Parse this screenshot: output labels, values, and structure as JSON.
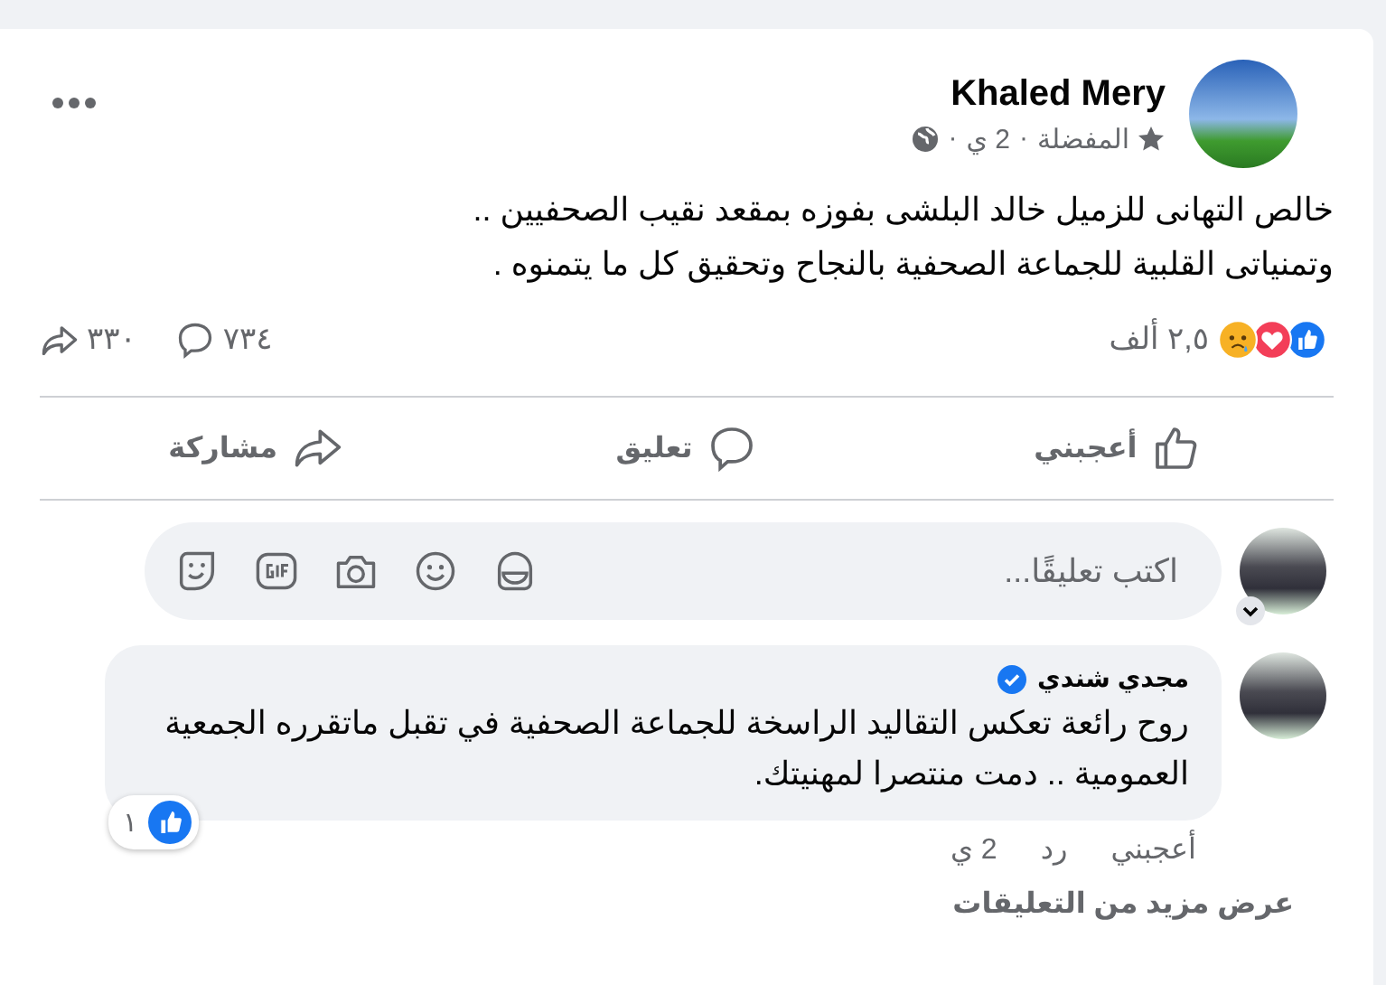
{
  "post": {
    "author": "Khaled Mery",
    "audience": "المفضلة",
    "separator": "·",
    "time": "2 ي",
    "text_lines": [
      "خالص التهانى للزميل خالد البلشى بفوزه بمقعد نقيب الصحفيين ..",
      "وتمنياتى القلبية للجماعة الصحفية بالنجاح وتحقيق كل ما يتمنوه ."
    ],
    "reactions": [
      {
        "kind": "like"
      },
      {
        "kind": "love"
      },
      {
        "kind": "sad"
      }
    ],
    "reaction_count": "٢,٥ ألف",
    "comment_count": "٧٣٤",
    "share_count": "٣٣٠",
    "actions": [
      {
        "kind": "like",
        "label": "أعجبني"
      },
      {
        "kind": "comment",
        "label": "تعليق"
      },
      {
        "kind": "share",
        "label": "مشاركة"
      }
    ]
  },
  "composer": {
    "placeholder": "اكتب تعليقًا..."
  },
  "comments": [
    {
      "author": "مجدي شندي",
      "verified": true,
      "text": "روح رائعة تعكس التقاليد الراسخة للجماعة الصحفية في تقبل ماتقرره الجمعية العمومية .. دمت منتصرا لمهنيتك.",
      "like_count": "١",
      "actions": [
        "أعجبني",
        "رد"
      ],
      "time": "2 ي"
    }
  ],
  "more_comments": "عرض مزيد من التعليقات"
}
